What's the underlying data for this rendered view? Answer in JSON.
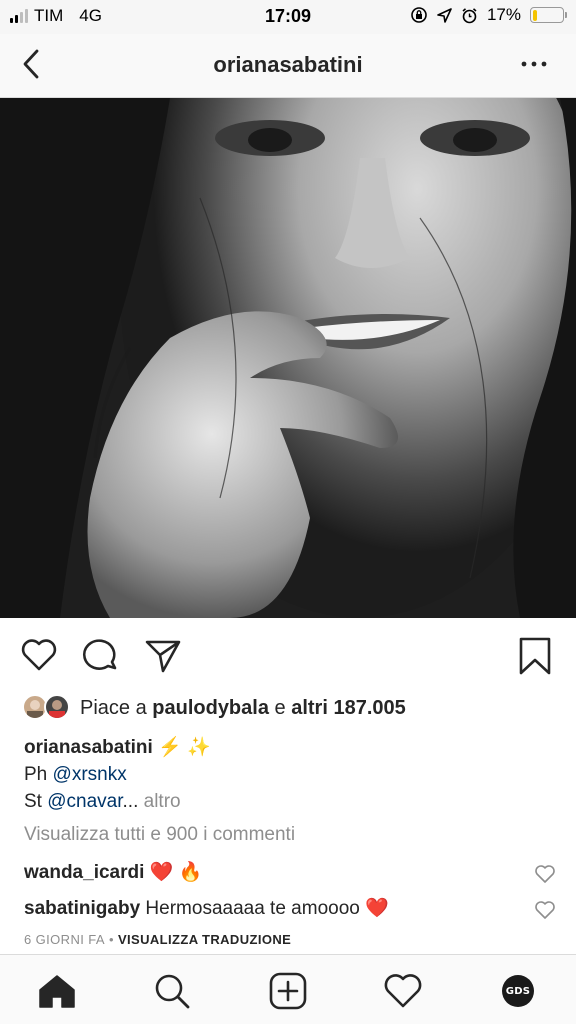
{
  "status_bar": {
    "carrier": "TIM",
    "network": "4G",
    "time": "17:09",
    "battery": "17%",
    "battery_level": 0.17,
    "signal_bars": 4,
    "signal_bars_active": 2
  },
  "header": {
    "title": "orianasabatini",
    "back_icon": "chevron-left-icon",
    "more_icon": "ellipsis-icon"
  },
  "post": {
    "actions": {
      "like_icon": "heart-icon",
      "comment_icon": "comment-bubble-icon",
      "share_icon": "paper-plane-icon",
      "save_icon": "bookmark-icon"
    },
    "likes": {
      "prefix": "Piace a ",
      "user": "paulodybala",
      "joiner": " e ",
      "others": "altri 187.005"
    },
    "caption": {
      "username": "orianasabatini",
      "emoji": " ⚡️ ✨",
      "line2_prefix": "Ph ",
      "line2_mention": "@xrsnkx",
      "line3_prefix": "St ",
      "line3_mention": "@cnavar",
      "ellipsis": "...",
      "more": " altro"
    },
    "view_comments": "Visualizza tutti e 900 i commenti",
    "comments": [
      {
        "user": "wanda_icardi",
        "text": " ❤️ 🔥"
      },
      {
        "user": "sabatinigaby",
        "text": " Hermosaaaaa te amoooo ❤️"
      }
    ],
    "timestamp": "6 GIORNI FA",
    "separator": "•",
    "translate": "VISUALIZZA TRADUZIONE"
  },
  "bottom_nav": {
    "items": [
      "home-icon",
      "search-icon",
      "add-post-icon",
      "activity-heart-icon",
      "profile-avatar"
    ],
    "profile_initials": "GDS"
  },
  "colors": {
    "text": "#262626",
    "secondary": "#8e8e8e",
    "mention": "#003569",
    "battery": "#f5c400"
  }
}
